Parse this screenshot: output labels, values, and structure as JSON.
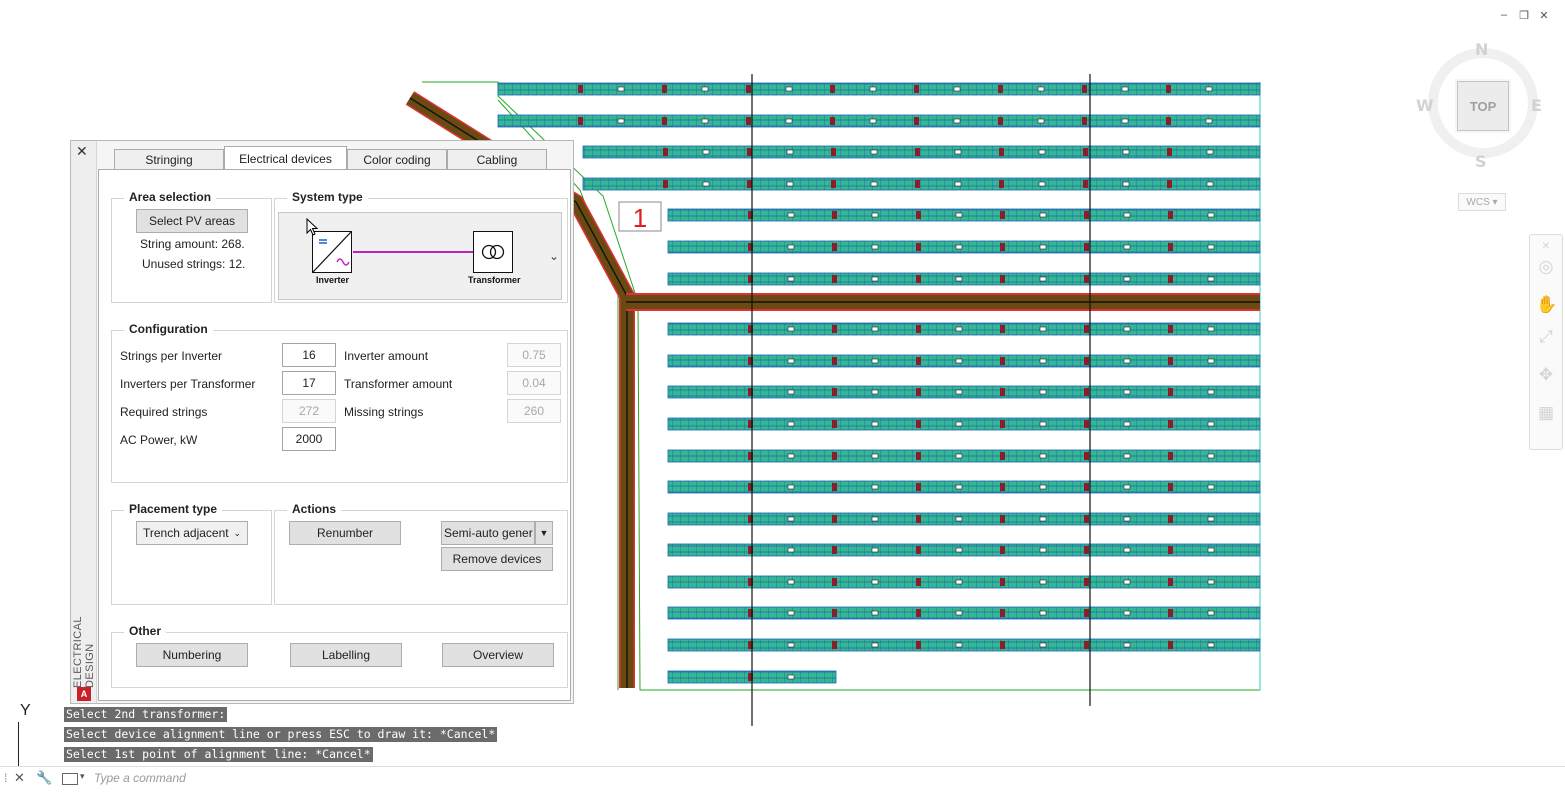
{
  "window_controls": {
    "minimize": "–",
    "restore": "❐",
    "close": "✕"
  },
  "viewcube": {
    "north": "N",
    "south": "S",
    "east": "E",
    "west": "W",
    "face": "TOP",
    "ucs_menu": "WCS"
  },
  "drawing": {
    "area_label": "1",
    "colors": {
      "module_fill": "#2fb58e",
      "module_stroke": "#1a73c0",
      "boundary": "#18a018",
      "trench": "#6b4a12",
      "trench_outline": "#e0303a",
      "alignment": "#111111"
    }
  },
  "palette": {
    "vertical_title": "ELECTRICAL DESIGN",
    "close": "✕",
    "logo": "A",
    "tabs": [
      "Stringing",
      "Electrical devices",
      "Color coding",
      "Cabling"
    ],
    "active_tab": "Electrical devices",
    "area_selection": {
      "title": "Area selection",
      "button": "Select PV areas",
      "string_amount": "String amount: 268.",
      "unused_strings": "Unused strings: 12."
    },
    "system_type": {
      "title": "System type",
      "device1": "Inverter",
      "device2": "Transformer",
      "dropdown_icon": "⌄"
    },
    "configuration": {
      "title": "Configuration",
      "strings_per_inverter_label": "Strings per Inverter",
      "strings_per_inverter": "16",
      "inverters_per_transformer_label": "Inverters per Transformer",
      "inverters_per_transformer": "17",
      "required_strings_label": "Required strings",
      "required_strings": "272",
      "ac_power_label": "AC Power, kW",
      "ac_power": "2000",
      "inverter_amount_label": "Inverter amount",
      "inverter_amount": "0.75",
      "transformer_amount_label": "Transformer amount",
      "transformer_amount": "0.04",
      "missing_strings_label": "Missing strings",
      "missing_strings": "260"
    },
    "placement_type": {
      "title": "Placement type",
      "selected": "Trench adjacent"
    },
    "actions": {
      "title": "Actions",
      "renumber": "Renumber",
      "generation_mode": "Semi-auto gener",
      "remove_devices": "Remove devices"
    },
    "other": {
      "title": "Other",
      "numbering": "Numbering",
      "labelling": "Labelling",
      "overview": "Overview"
    }
  },
  "command": {
    "history": [
      "Select 2nd transformer:",
      "Select device alignment line or press ESC to draw it: *Cancel*",
      "Select 1st point of alignment line: *Cancel*"
    ],
    "placeholder": "Type a command",
    "ucs_y": "Y"
  }
}
